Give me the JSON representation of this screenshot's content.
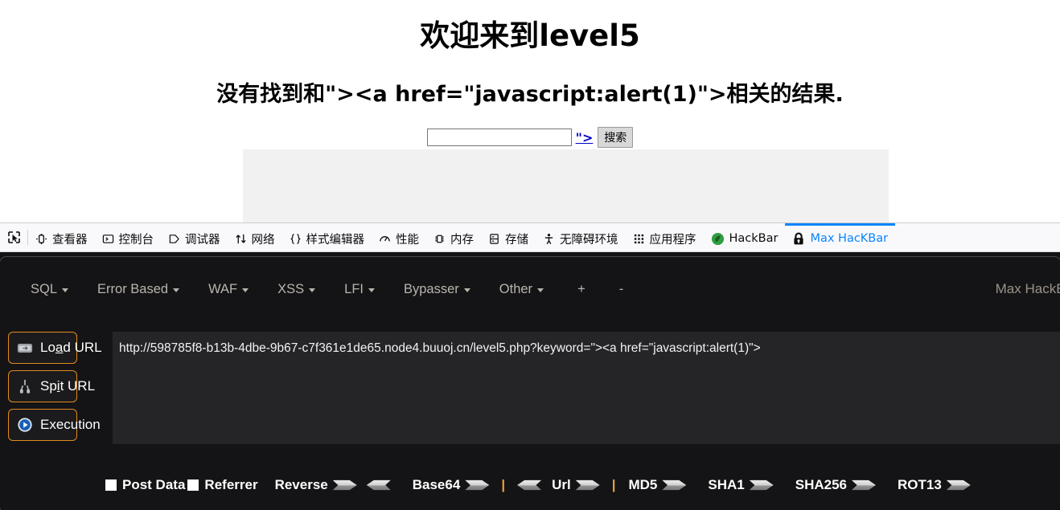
{
  "page": {
    "title": "欢迎来到level5",
    "subtitle": "没有找到和\"><a href=\"javascript:alert(1)\">相关的结果.",
    "search": {
      "value": "",
      "placeholder": "",
      "injected_link_text": "\">",
      "button_label": "搜索"
    }
  },
  "devtools": {
    "picker_icon": "element-picker-icon",
    "tabs": [
      {
        "label": "查看器",
        "icon": "inspector-icon",
        "active": false
      },
      {
        "label": "控制台",
        "icon": "console-icon",
        "active": false
      },
      {
        "label": "调试器",
        "icon": "debugger-icon",
        "active": false
      },
      {
        "label": "网络",
        "icon": "network-icon",
        "active": false
      },
      {
        "label": "样式编辑器",
        "icon": "style-editor-icon",
        "active": false
      },
      {
        "label": "性能",
        "icon": "performance-icon",
        "active": false
      },
      {
        "label": "内存",
        "icon": "memory-icon",
        "active": false
      },
      {
        "label": "存储",
        "icon": "storage-icon",
        "active": false
      },
      {
        "label": "无障碍环境",
        "icon": "accessibility-icon",
        "active": false
      },
      {
        "label": "应用程序",
        "icon": "application-icon",
        "active": false
      },
      {
        "label": "HackBar",
        "icon": "hackbar-leaf-icon",
        "active": false
      },
      {
        "label": "Max HacKBar",
        "icon": "padlock-icon",
        "active": true
      }
    ],
    "active_tab_color": "#0a84ff"
  },
  "hackbar": {
    "brand": "Max HackBa",
    "menu": [
      {
        "label": "SQL",
        "has_caret": true
      },
      {
        "label": "Error Based",
        "has_caret": true
      },
      {
        "label": "WAF",
        "has_caret": true
      },
      {
        "label": "XSS",
        "has_caret": true
      },
      {
        "label": "LFI",
        "has_caret": true
      },
      {
        "label": "Bypasser",
        "has_caret": true
      },
      {
        "label": "Other",
        "has_caret": true
      }
    ],
    "add_tab_label": "+",
    "remove_tab_label": "-",
    "actions": [
      {
        "label": "Load URL",
        "icon": "load-url-icon",
        "accesskey": "a"
      },
      {
        "label": "Spit URL",
        "icon": "split-url-icon",
        "accesskey": "i"
      },
      {
        "label": "Execution",
        "icon": "execute-play-icon",
        "accesskey": ""
      }
    ],
    "url_value": "http://598785f8-b13b-4dbe-9b67-c7f361e1de65.node4.buuoj.cn/level5.php?keyword=\"><a href=\"javascript:alert(1)\">",
    "bottom": {
      "post_data_label": "Post Data",
      "post_data_checked": false,
      "referrer_label": "Referrer",
      "referrer_checked": false,
      "tools": [
        {
          "label": "Reverse",
          "arrows": [
            "right",
            "left"
          ]
        },
        {
          "label": "Base64",
          "arrows": [
            "right"
          ]
        },
        {
          "sep": "|"
        },
        {
          "label": "Url",
          "arrows": [
            "left",
            "right"
          ],
          "leading_arrow": true
        },
        {
          "sep": "|"
        },
        {
          "label": "MD5",
          "arrows": [
            "right"
          ]
        },
        {
          "label": "SHA1",
          "arrows": [
            "right"
          ]
        },
        {
          "label": "SHA256",
          "arrows": [
            "right"
          ]
        },
        {
          "label": "ROT13",
          "arrows": [
            "right"
          ]
        }
      ]
    },
    "accent_border_color": "#e08a1e",
    "panel_bg": "#141416",
    "textarea_bg": "#252528"
  }
}
